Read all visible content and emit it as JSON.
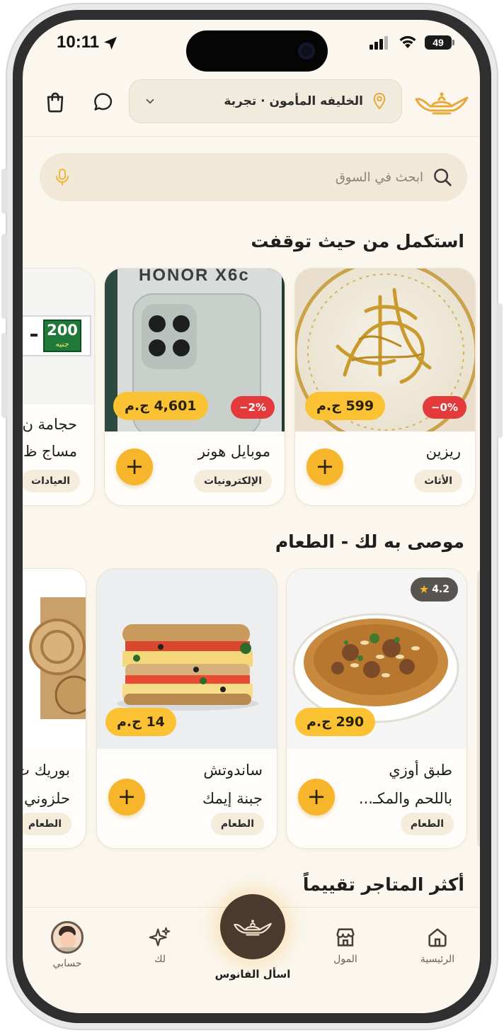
{
  "status_bar": {
    "time": "10:11",
    "battery": "49"
  },
  "header": {
    "location": "الخليفه المأمون · تجربة"
  },
  "search": {
    "placeholder": "ابحث في السوق"
  },
  "continue_section": {
    "title": "استكمل من حيث توقفت",
    "items": [
      {
        "name": "ريزين",
        "price": "599 ج.م",
        "discount": "−0%",
        "category": "الأثاث"
      },
      {
        "name": "موبايل هونر",
        "price": "4,601 ج.م",
        "discount": "−2%",
        "category": "الإلكترونيات",
        "image_text": "HONOR X6c"
      },
      {
        "name_line1": "حجامة ن",
        "name_line2": "مساج ظ",
        "category": "العيادات",
        "badge_number": "200",
        "badge_word": "جنيه"
      }
    ]
  },
  "recommended_section": {
    "title": "موصى به لك - الطعام",
    "items": [
      {
        "name_line1": "طبق أوزي",
        "name_line2": "باللحم والمكـ...",
        "price": "290 ج.م",
        "category": "الطعام",
        "rating": "4.2"
      },
      {
        "name_line1": "ساندوتش",
        "name_line2": "جبنة إيمك",
        "price": "14 ج.م",
        "category": "الطعام"
      },
      {
        "name_line1": "بوريك ت",
        "name_line2": "حلزوني",
        "category": "الطعام"
      }
    ]
  },
  "top_stores_section": {
    "title": "أكثر المتاجر تقييماً"
  },
  "bottom_nav": {
    "home": "الرئيسية",
    "mall": "المول",
    "ask_lamp": "اسأل الفانوس",
    "for_you": "لك",
    "account": "حسابي"
  },
  "colors": {
    "accent": "#F7B52B",
    "background": "#FBF7EE",
    "discount": "#E33B3B",
    "lamp_button": "#4A3A2E"
  }
}
